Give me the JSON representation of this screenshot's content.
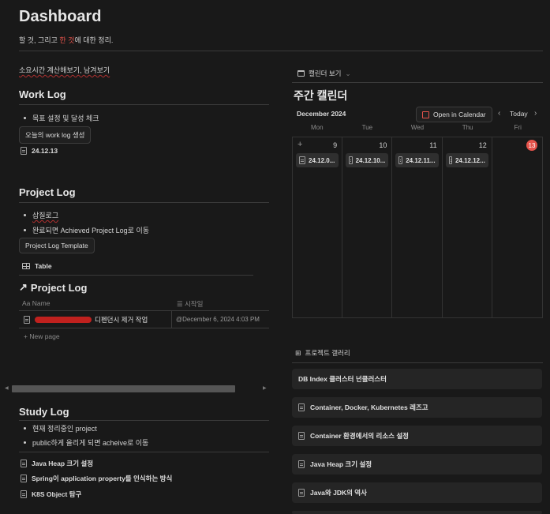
{
  "header": {
    "title": "Dashboard",
    "subtitle_pre": "할 것, 그리고 ",
    "subtitle_red": "한 것",
    "subtitle_post": "에 대한 정리."
  },
  "calc_link": "소요시간 계산해보기, 남겨보기",
  "work_log": {
    "title": "Work Log",
    "bullet": "목표 설정 및 달성 체크",
    "button": "오늘의 work log 생성",
    "page": "24.12.13"
  },
  "project_log": {
    "title": "Project Log",
    "bullets": [
      "삽질로그",
      "완료되면 Achieved Project Log로 이동"
    ],
    "button": "Project Log Template",
    "view_label": "Table",
    "db_title": "Project Log",
    "col_name": "Name",
    "col_start": "시작일",
    "row_name": "디펜던시 제거 작업",
    "row_date": "@December 6, 2024 4:03 PM",
    "new_page": "+ New page"
  },
  "study_log": {
    "title": "Study Log",
    "bullets": [
      "현재 정리중인 project",
      "public하게 올리게 되면 acheive로 이동"
    ],
    "pages": [
      "Java Heap 크기 설정",
      "Spring이 application property를 인식하는 방식",
      "K8S Object 탐구"
    ]
  },
  "calendar": {
    "view_label": "캘린더 보기",
    "title": "주간 캘린더",
    "month": "December 2024",
    "open_btn": "Open in Calendar",
    "today_btn": "Today",
    "days": [
      "Mon",
      "Tue",
      "Wed",
      "Thu",
      "Fri"
    ],
    "dates": [
      "9",
      "10",
      "11",
      "12",
      "13"
    ],
    "events": [
      "24.12.0...",
      "24.12.10...",
      "24.12.11...",
      "24.12.12..."
    ]
  },
  "gallery": {
    "label": "프로젝트 갤러리",
    "items": [
      "DB Index 클러스터 넌클러스터",
      "Container, Docker, Kubernetes 레즈고",
      "Container 환경에서의 리소스 설정",
      "Java Heap 크기 설정",
      "Java와 JDK의 역사"
    ]
  },
  "colors": {
    "accent_red": "#e5534b",
    "bg": "#191919"
  }
}
